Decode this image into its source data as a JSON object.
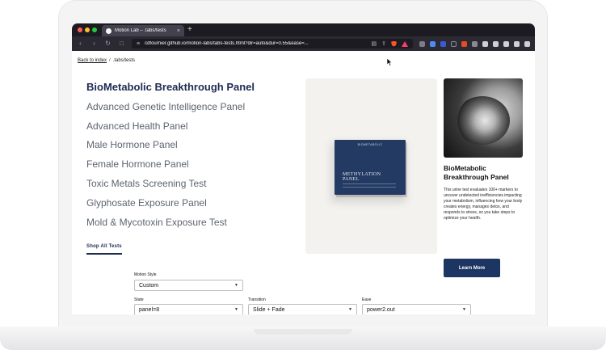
{
  "browser": {
    "tab_title": "Motion Lab – .tabs/tests",
    "tab_close": "×",
    "new_tab": "+",
    "url": "cdfournier.github.io/motion-labs/tabs-tests.html?dir=auto&dur=0.55&ease=..."
  },
  "page": {
    "breadcrumb": {
      "back_link": "Back to index",
      "separator": "/",
      "current": ".tabs/tests"
    },
    "tests": [
      "BioMetabolic Breakthrough Panel",
      "Advanced Genetic Intelligence Panel",
      "Advanced Health Panel",
      "Male Hormone Panel",
      "Female Hormone Panel",
      "Toxic Metals Screening Test",
      "Glyphosate Exposure Panel",
      "Mold & Mycotoxin Exposure Test"
    ],
    "active_test_index": 0,
    "shop_all": "Shop All Tests",
    "product_box": {
      "brand": "BIOMETABOLIC",
      "title_line1": "METHYLATION",
      "title_line2": "PANEL"
    },
    "card": {
      "title": "BioMetabolic Breakthrough Panel",
      "description": "This urine test evaluates 100+ markers to uncover undetected inefficiencies impacting your metabolism, influencing how your body creates energy, manages detox, and responds to stress, so you take steps to optimize your health.",
      "button": "Learn More"
    },
    "controls": {
      "motion_style": {
        "label": "Motion Style",
        "value": "Custom"
      },
      "state": {
        "label": "State",
        "value": "panel=8"
      },
      "transition": {
        "label": "Transition",
        "value": "Slide + Fade"
      },
      "ease": {
        "label": "Ease",
        "value": "power2.out"
      }
    }
  },
  "colors": {
    "brand_navy": "#1d2b52",
    "button_navy": "#1d3563",
    "chrome_dark": "#1c1b22"
  }
}
